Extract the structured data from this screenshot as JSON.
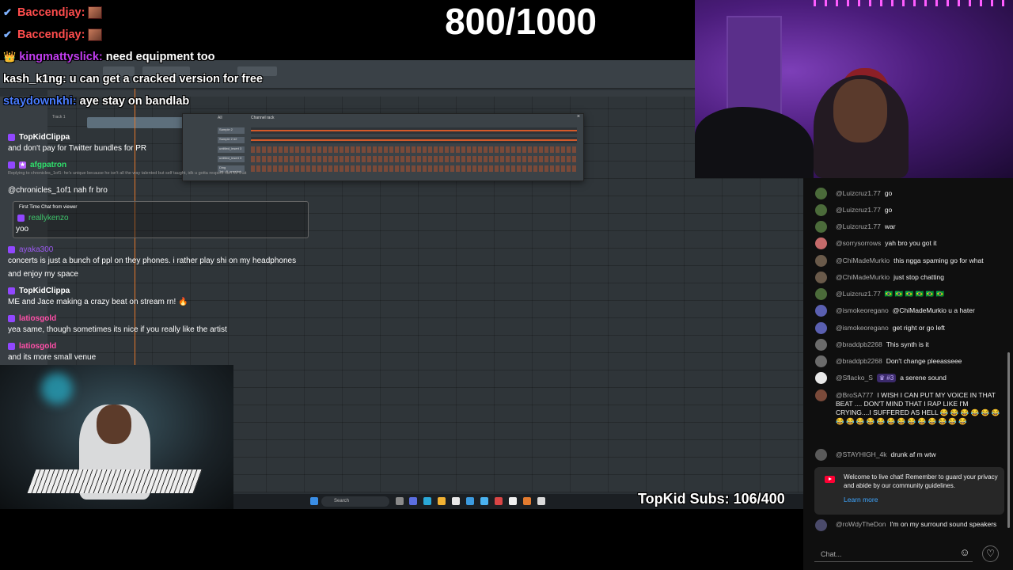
{
  "goal": {
    "text": "800/1000"
  },
  "subs": {
    "text": "TopKid Subs: 106/400"
  },
  "top_chat": [
    {
      "badge": "✔",
      "user": "Baccendjay:",
      "user_color": "#ff4d4d",
      "text": "",
      "emote": true
    },
    {
      "badge": "✔",
      "user": "Baccendjay:",
      "user_color": "#ff4d4d",
      "text": "",
      "emote": true
    },
    {
      "badge": "👑",
      "user": "kingmattyslick:",
      "user_color": "#c23df0",
      "text": "need equipment too",
      "emote": false
    },
    {
      "badge": "",
      "user": "kash_k1ng:",
      "user_color": "#ffffff",
      "text": "u can get a cracked version for free",
      "emote": false
    },
    {
      "badge": "✔",
      "user": "staydownkhi:",
      "user_color": "#4a7dff",
      "text": "aye stay on bandlab",
      "emote": false
    }
  ],
  "left_chat": {
    "user_topkid_1": "TopKidClippa",
    "msg_1": "and don't pay for Twitter bundles for PR",
    "user_afg": "afgpatron",
    "reply_text": "Replying to chronicles_1of1: he's unique because he isn't all the way talented but self taught, idk u gotta respect him for that",
    "msg_2": "@chronicles_1of1 nah fr bro",
    "ftc_label": "First Time Chat from viewer",
    "user_kenzo": "reallykenzo",
    "msg_kenzo": "yoo",
    "user_ayaka": "ayaka300",
    "msg_ayaka_1": "concerts is just a bunch of ppl on they phones. i rather play shi on my headphones",
    "msg_ayaka_2": "and enjoy my space",
    "user_topkid_2": "TopKidClippa",
    "msg_topkid_2": "ME and Jace making a crazy beat on stream rn! 🔥",
    "user_latios_1": "latiosgold",
    "msg_latios_1": "yea same, though sometimes its nice if you really like the artist",
    "user_latios_2": "latiosgold",
    "msg_latios_2": "and its more small venue"
  },
  "daw": {
    "channel_rack_title": "Channel rack",
    "channel_rack_filter": "All",
    "track_label": "Track 1",
    "channels": [
      "Sample 2",
      "Sample 2 #2",
      "untitled_insert 3",
      "untitled_insert 3",
      "Ding 1st...8_oneshot"
    ],
    "taskbar_search": "Search"
  },
  "yt_chat": {
    "messages": [
      {
        "author": "@Luizcruz1.77",
        "text": "go",
        "avatar_color": "#4b6b3a"
      },
      {
        "author": "@Luizcruz1.77",
        "text": "go",
        "avatar_color": "#4b6b3a"
      },
      {
        "author": "@Luizcruz1.77",
        "text": "war",
        "avatar_color": "#4b6b3a"
      },
      {
        "author": "@sorrysorrows",
        "text": "yah bro you got it",
        "avatar_color": "#c46a6a"
      },
      {
        "author": "@ChiMadeMurkio",
        "text": "this ngga spaming go for what",
        "avatar_color": "#6a5a4a"
      },
      {
        "author": "@ChiMadeMurkio",
        "text": "just stop chatting",
        "avatar_color": "#6a5a4a"
      },
      {
        "author": "@Luizcruz1.77",
        "text": "🇧🇷 🇧🇷 🇧🇷 🇧🇷 🇧🇷 🇧🇷",
        "avatar_color": "#4b6b3a"
      },
      {
        "author": "@ismokeoregano",
        "text": "@ChiMadeMurkio u a hater",
        "avatar_color": "#5a5fb0"
      },
      {
        "author": "@ismokeoregano",
        "text": "get right or go left",
        "avatar_color": "#5a5fb0"
      },
      {
        "author": "@braddpb2268",
        "text": "This synth is it",
        "avatar_color": "#6b6b6b"
      },
      {
        "author": "@braddpb2268",
        "text": "Don't change pleeasseee",
        "avatar_color": "#6b6b6b"
      },
      {
        "author": "@Sflacko_S",
        "member_badge": "♛ #3",
        "text": "a serene sound",
        "avatar_color": "#e8e8e8"
      },
      {
        "author": "@BroSA777",
        "text": "I WISH I CAN PUT MY VOICE IN THAT BEAT .... DON'T MIND THAT I RAP LIKE I'M CRYING....I SUFFERED AS HELL 😂 😂 😂 😂 😂 😂 😂 😂 😂 😂 😂 😂 😂 😂 😂 😂 😂 😂 😂",
        "avatar_color": "#7a4a3a"
      },
      {
        "author": "@STAYHIGH_4k",
        "text": "drunk af m wtw",
        "avatar_color": "#5a5a5a"
      }
    ],
    "notice_text": "Welcome to live chat! Remember to guard your privacy and abide by our community guidelines.",
    "notice_link": "Learn more",
    "last_message": {
      "author": "@roWdyTheDon",
      "text": "I'm on my surround sound speakers",
      "avatar_color": "#4a4a6a"
    },
    "input_placeholder": "Chat..."
  }
}
